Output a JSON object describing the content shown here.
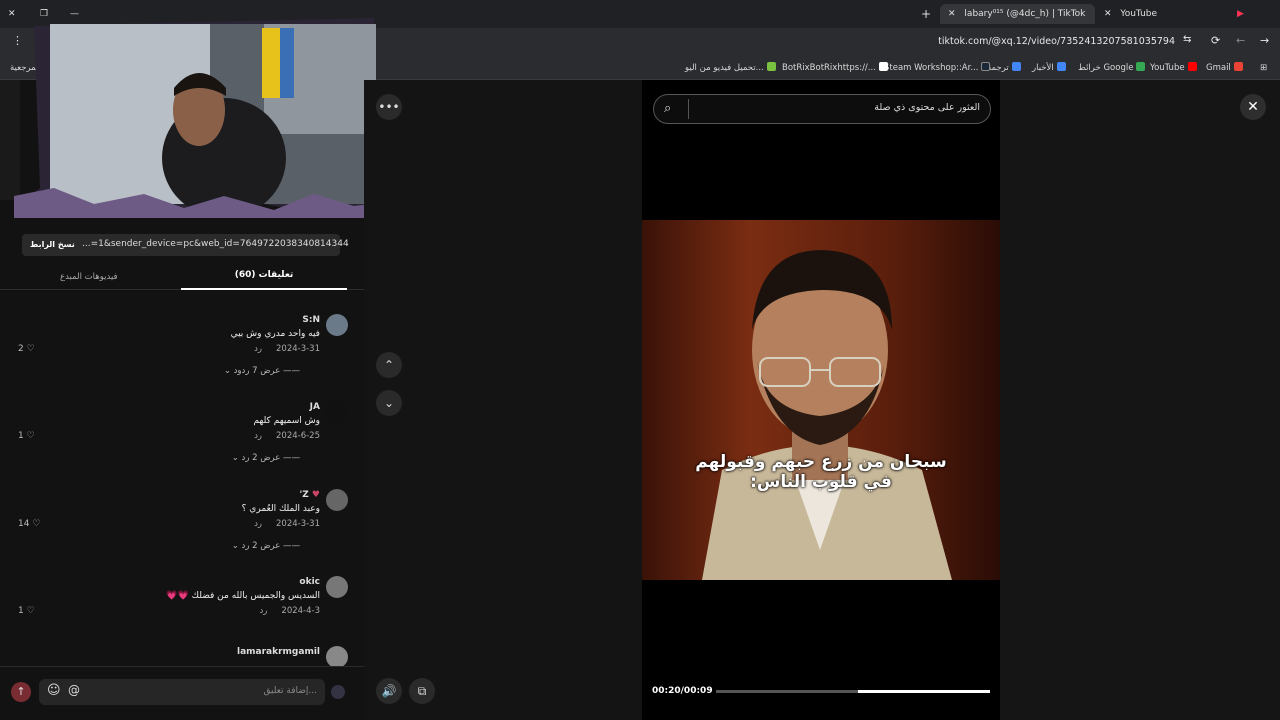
{
  "browser": {
    "tabs": [
      {
        "label": "labary⁰¹⁵ (@4dc_h) | TikTok",
        "active": true
      },
      {
        "label": "YouTube",
        "active": false
      }
    ],
    "new_tab": "+",
    "url": "tiktok.com/@xq.12/video/7352413207581035794",
    "bookmarks_left": "المرجعية",
    "bookmarks": [
      {
        "label": "Gmail",
        "color": "#ea4335"
      },
      {
        "label": "YouTube",
        "color": "#ff0000"
      },
      {
        "label": "خرائط Google",
        "color": "#34a853"
      },
      {
        "label": "الأخبار",
        "color": "#4285f4"
      },
      {
        "label": "ترجمة",
        "color": "#4285f4"
      },
      {
        "label": "Steam Workshop::Ar...",
        "color": "#1b2838"
      },
      {
        "label": "BotRixBotRixhttps://...",
        "color": "#ffffff"
      },
      {
        "label": "تحميل فيديو من اليو...",
        "color": "#7ac142"
      }
    ]
  },
  "left": {
    "copy_link": "نسخ الرابط",
    "link_text": "...=1&sender_device=pc&web_id=7649722038340814344",
    "tabs": {
      "comments": "تعليقات (60)",
      "creator_videos": "فيديوهات المبدع"
    },
    "comments": [
      {
        "user": "S:N",
        "text": "فيه واحد مدري وش بيي",
        "date": "2024-3-31",
        "reply": "رد",
        "likes": "2",
        "replies": "عرض 7 ردود",
        "avatar_color": "#6b7a88"
      },
      {
        "user": "JA",
        "text": "وش اسميهم كلهم",
        "date": "2024-6-25",
        "reply": "رد",
        "likes": "1",
        "replies": "عرض 2 رد",
        "avatar_color": "#111111"
      },
      {
        "user": "Z'",
        "text": "وعبد الملك العُمري ؟",
        "date": "2024-3-31",
        "reply": "رد",
        "likes": "14",
        "replies": "عرض 2 رد",
        "avatar_color": "#666666"
      },
      {
        "user": "okic",
        "text": "السديس والجميس بالله من فضلك 💗💗",
        "date": "2024-4-3",
        "reply": "رد",
        "likes": "1",
        "replies": "",
        "avatar_color": "#777777"
      },
      {
        "user": "lamarakrmgamil",
        "text": "...",
        "date": "",
        "reply": "",
        "likes": "",
        "replies": "",
        "avatar_color": "#888888"
      }
    ],
    "comment_placeholder": "إضافة تعليق...",
    "emoji_label": "☺",
    "mention_label": "@"
  },
  "video": {
    "search_placeholder": "العثور على محتوى ذي صلة",
    "caption_line1": "سبحان من زرع حبهم وقبولهم",
    "caption_line2": "في قلوب الناس:",
    "time": "00:20/00:09",
    "progress": 0.48
  }
}
